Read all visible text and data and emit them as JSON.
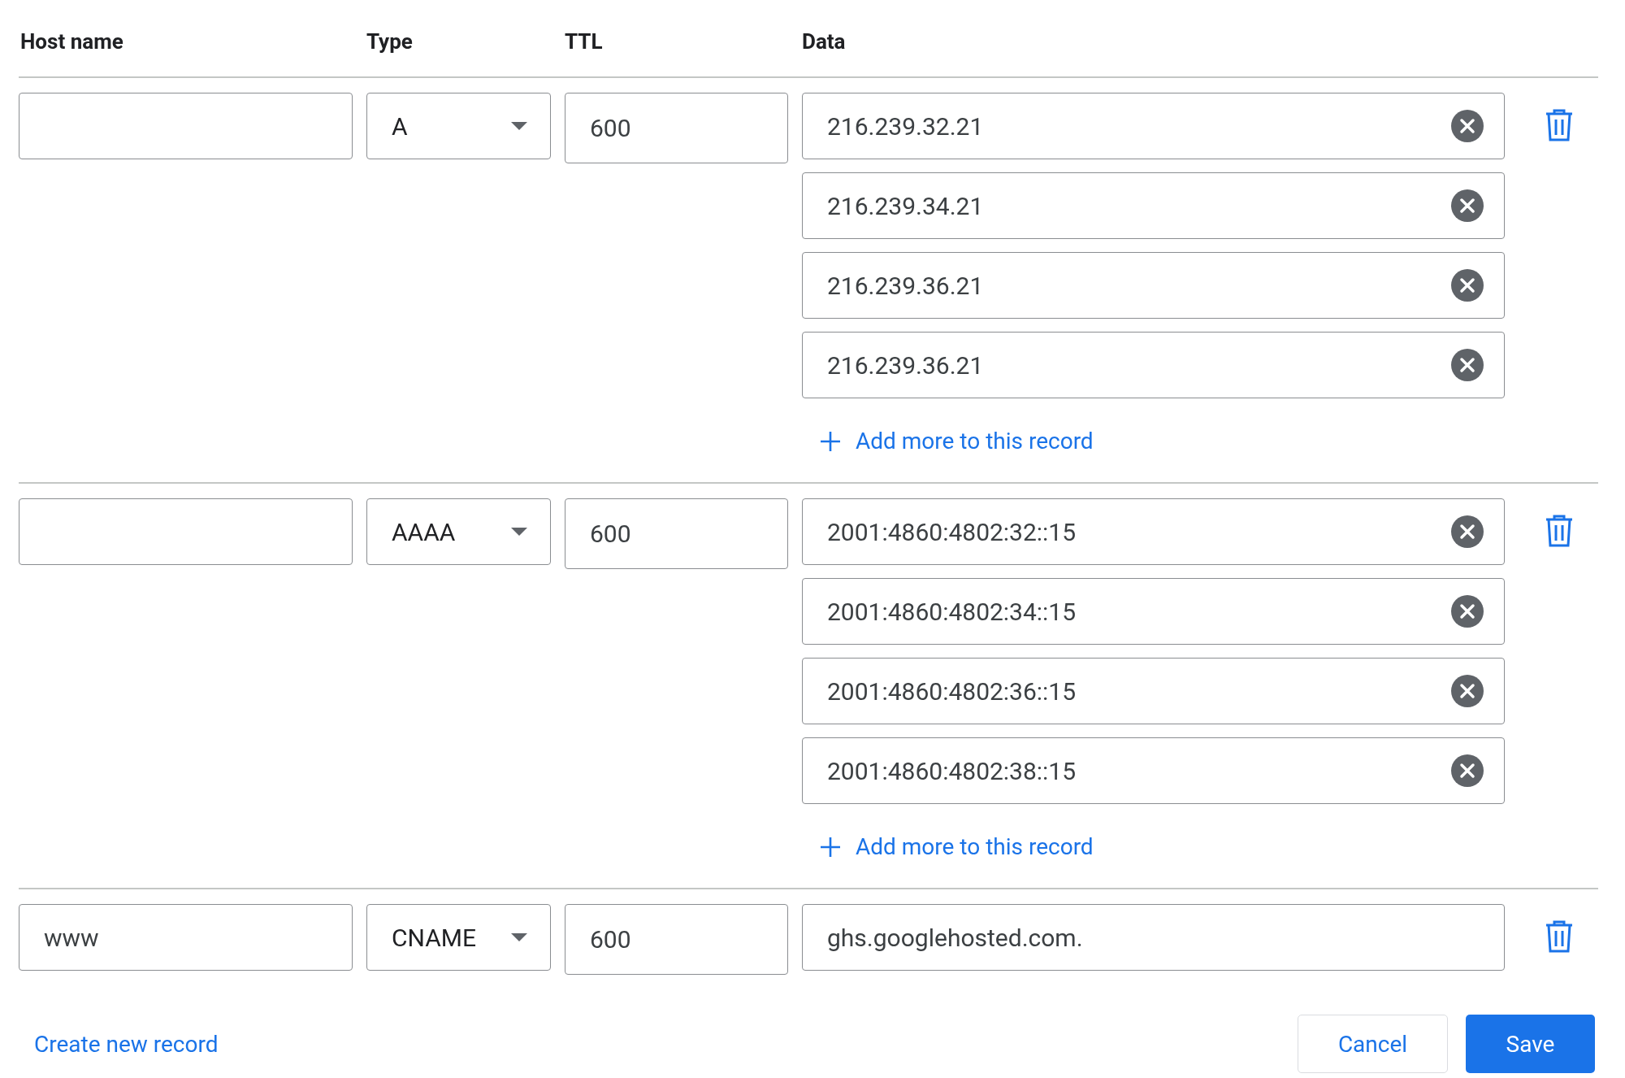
{
  "columns": [
    "Host name",
    "Type",
    "TTL",
    "Data"
  ],
  "records": [
    {
      "type": "A",
      "ttl": "600",
      "values": [
        {
          "value": "216.239.32.21",
          "removable": true
        },
        {
          "value": "216.239.34.21",
          "removable": true
        },
        {
          "value": "216.239.36.21",
          "removable": true
        },
        {
          "value": "216.239.36.21",
          "removable": true
        }
      ],
      "add_more": "Add more to this record"
    },
    {
      "type": "AAAA",
      "ttl": "600",
      "values": [
        {
          "value": "2001:4860:4802:32::15",
          "removable": true
        },
        {
          "value": "2001:4860:4802:34::15",
          "removable": true
        },
        {
          "value": "2001:4860:4802:36::15",
          "removable": true
        },
        {
          "value": "2001:4860:4802:38::15",
          "removable": true
        }
      ],
      "add_more": "Add more to this record"
    },
    {
      "host": "www",
      "type": "CNAME",
      "ttl": "600",
      "values": [
        {
          "value": "ghs.googlehosted.com.",
          "removable": false
        }
      ]
    }
  ],
  "create_link": "Create new record",
  "buttons": {
    "cancel": "Cancel",
    "save": "Save"
  }
}
